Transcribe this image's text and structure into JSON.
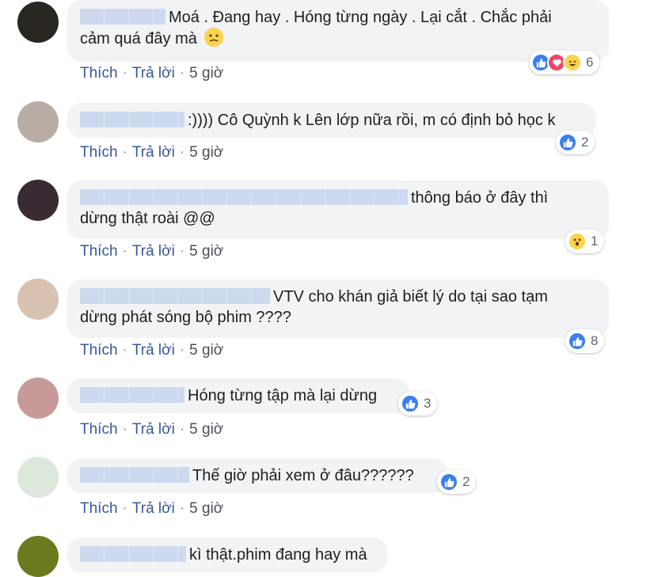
{
  "actions": {
    "like": "Thích",
    "reply": "Trả lời",
    "time": "5 giờ",
    "sep": "·"
  },
  "comments": [
    {
      "line1": "Moá . Đang hay . Hóng từng ngày . Lại cắt . Chắc phải",
      "line2": "cảm quá đây mà",
      "reactions": [
        "like-icon",
        "love-icon",
        "haha-icon"
      ],
      "count": "6"
    },
    {
      "line1": ":)))) Cô Quỳnh k Lên lớp nữa rồi, m có định bỏ học k",
      "reactions": [
        "like-icon"
      ],
      "count": "2"
    },
    {
      "line1": "thông báo ở đây thì",
      "line2": "dừng thật roài @@",
      "reactions": [
        "wow-icon"
      ],
      "count": "1"
    },
    {
      "line1": "VTV cho khán giả biết lý do tại sao tạm",
      "line2": "dừng phát sóng bộ phim ????",
      "reactions": [
        "like-icon"
      ],
      "count": "8"
    },
    {
      "line1": "Hóng từng tập mà lại dừng",
      "reactions": [
        "like-icon"
      ],
      "count": "3"
    },
    {
      "line1": "Thế giờ phải xem ở đâu??????",
      "reactions": [
        "like-icon"
      ],
      "count": "2"
    },
    {
      "line1": "kì thật.phim đang hay mà"
    }
  ],
  "colors": {
    "link": "#385898",
    "bubble": "#f2f3f5",
    "like": "#3b7ff0",
    "love": "#f0456a",
    "emoji": "#fcd34d"
  }
}
